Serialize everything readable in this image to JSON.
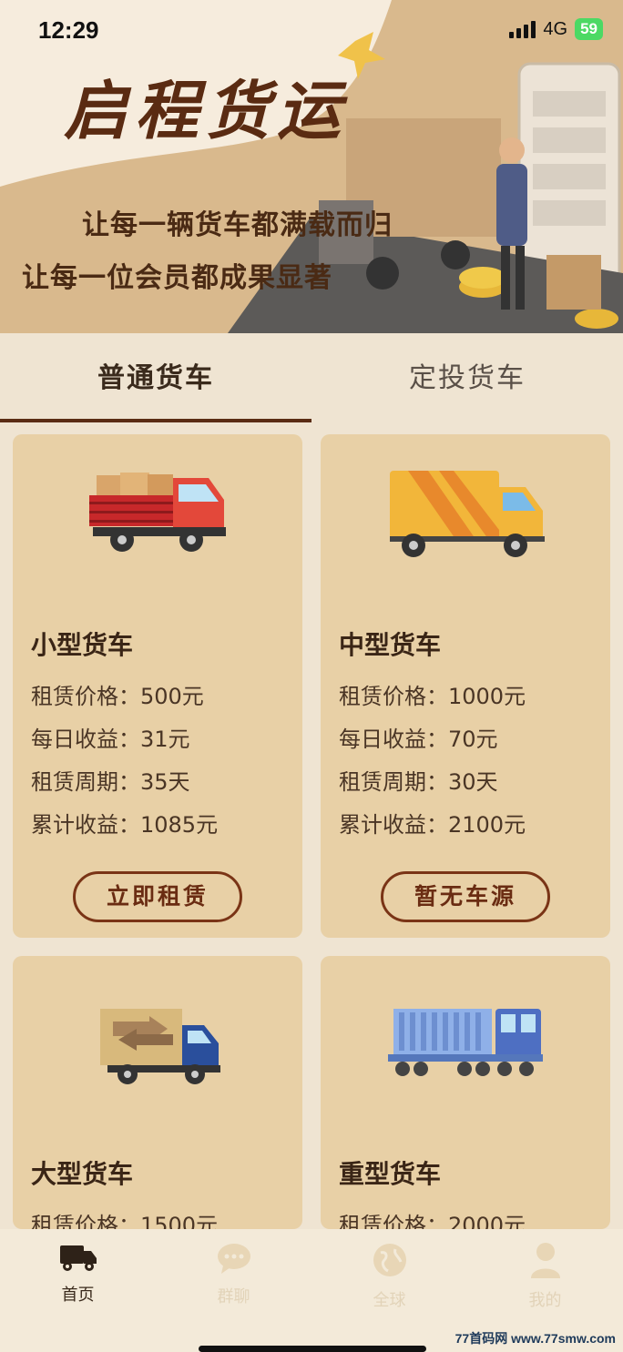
{
  "status_bar": {
    "time": "12:29",
    "network": "4G",
    "battery": "59"
  },
  "banner": {
    "brand": "启程货运",
    "slogan_1": "让每一辆货车都满载而归",
    "slogan_2": "让每一位会员都成果显著"
  },
  "tabs": [
    {
      "label": "普通货车",
      "active": true
    },
    {
      "label": "定投货车",
      "active": false
    }
  ],
  "cards": [
    {
      "title": "小型货车",
      "rows": [
        "租赁价格：500元",
        "每日收益：31元",
        "租赁周期：35天",
        "累计收益：1085元"
      ],
      "button": "立即租赁",
      "truck_icon": "small-red-truck-icon"
    },
    {
      "title": "中型货车",
      "rows": [
        "租赁价格：1000元",
        "每日收益：70元",
        "租赁周期：30天",
        "累计收益：2100元"
      ],
      "button": "暂无车源",
      "truck_icon": "medium-yellow-truck-icon"
    },
    {
      "title": "大型货车",
      "rows": [
        "租赁价格：1500元"
      ],
      "truck_icon": "large-blue-truck-icon"
    },
    {
      "title": "重型货车",
      "rows": [
        "租赁价格：2000元"
      ],
      "truck_icon": "heavy-container-truck-icon"
    }
  ],
  "bottom_nav": [
    {
      "label": "首页",
      "icon": "truck-icon",
      "active": true
    },
    {
      "label": "群聊",
      "icon": "chat-icon",
      "active": false
    },
    {
      "label": "全球",
      "icon": "globe-icon",
      "active": false
    },
    {
      "label": "我的",
      "icon": "user-icon",
      "active": false
    }
  ],
  "watermark": "77首码网 www.77smw.com",
  "colors": {
    "accent": "#5a2c14",
    "card_bg": "#e8d0a6",
    "page_bg": "#efe4d2",
    "banner_bg": "#d9b98d"
  }
}
